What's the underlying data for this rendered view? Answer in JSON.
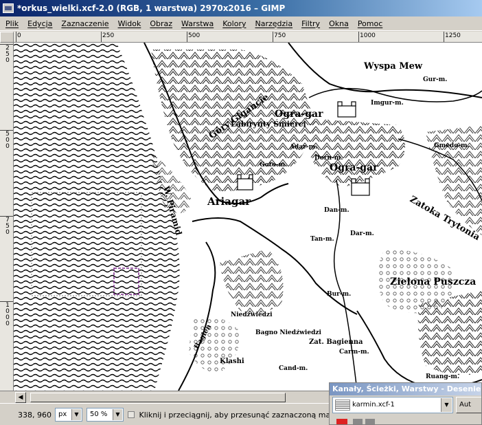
{
  "window": {
    "title": "*orkus_wielki.xcf-2.0 (RGB, 1 warstwa) 2970x2016 – GIMP"
  },
  "menu": [
    "Plik",
    "Edycja",
    "Zaznaczenie",
    "Widok",
    "Obraz",
    "Warstwa",
    "Kolory",
    "Narzędzia",
    "Filtry",
    "Okna",
    "Pomoc"
  ],
  "ruler": {
    "h_labels": [
      "0",
      "250",
      "500",
      "750",
      "1000",
      "1250"
    ],
    "v_labels": [
      "250",
      "500",
      "750",
      "1000"
    ]
  },
  "map": {
    "labels": [
      "Wyspa Mew",
      "Gur-m.",
      "Góry Gigancie",
      "Imgur-m.",
      "Ogra-gar",
      "Labirynty Śmierci",
      "Adar-m.",
      "Dorn-m.",
      "W. Piramid",
      "Goto-m.",
      "Ogra-gar",
      "Ariagar",
      "Dan-m.",
      "Dar-m.",
      "Tan-m.",
      "Zatoka Trytonia",
      "Zielona Puszcza",
      "Bur-m.",
      "Niedźwiedzi",
      "Bagno Niedźwiedzi",
      "Zat. Bagienna",
      "Carm-m.",
      "Cand-m.",
      "Klashi",
      "Bagien",
      "Gmedo-m.",
      "Ruang-m."
    ]
  },
  "statusbar": {
    "coords": "338, 960",
    "unit": "px",
    "zoom": "50 %",
    "message": "Kliknij i przeciągnij, aby przesunąć zaznaczoną maskę (prób"
  },
  "dock": {
    "title": "Kanały, Ścieżki, Warstwy - Desenie, Gr",
    "image_name": "karmin.xcf-1",
    "auto_label": "Aut"
  }
}
